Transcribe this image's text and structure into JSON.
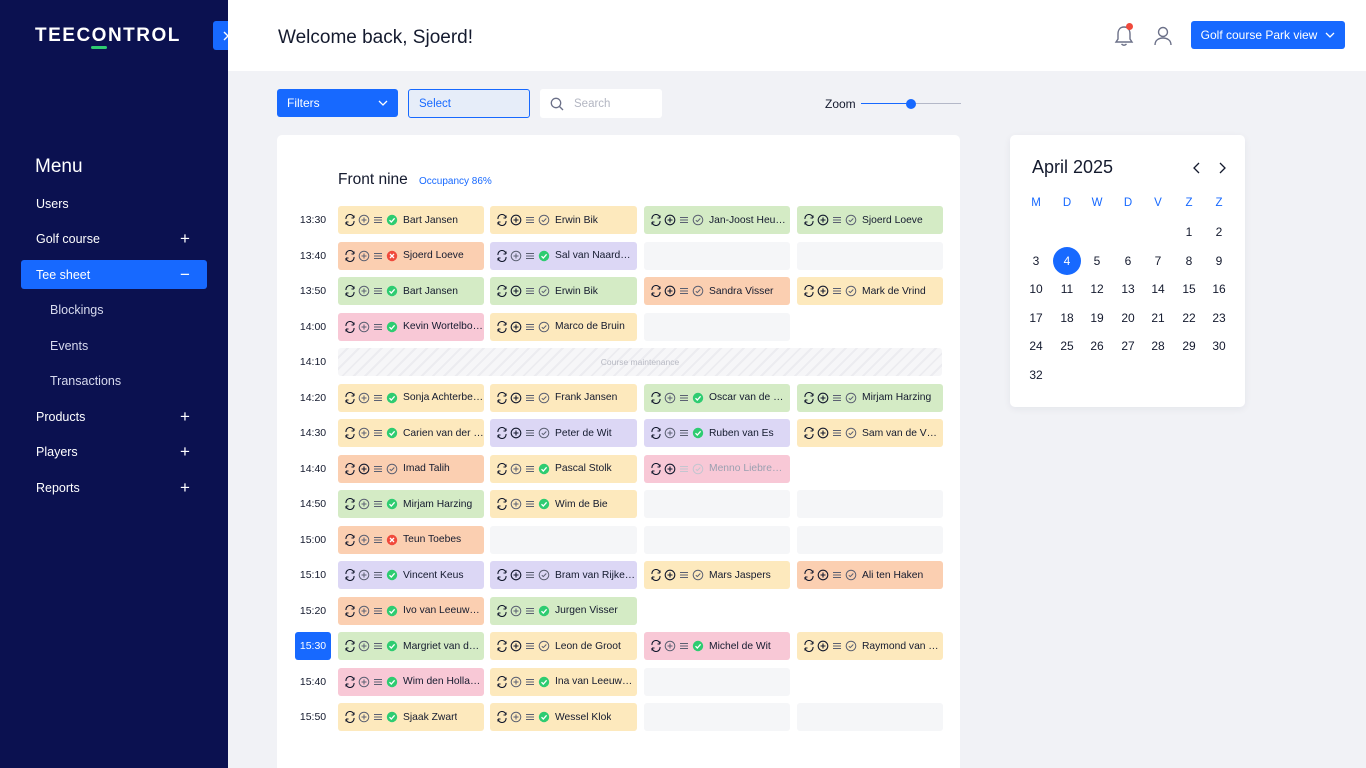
{
  "sidebar": {
    "logo": "TEECONTROL",
    "close_icon": "close-icon",
    "menu_title": "Menu",
    "items": [
      {
        "label": "Users",
        "toggle": "",
        "sub": false,
        "active": false
      },
      {
        "label": "Golf course",
        "toggle": "+",
        "sub": false,
        "active": false
      },
      {
        "label": "Tee sheet",
        "toggle": "−",
        "sub": false,
        "active": true
      },
      {
        "label": "Blockings",
        "toggle": "",
        "sub": true,
        "active": false
      },
      {
        "label": "Events",
        "toggle": "",
        "sub": true,
        "active": false
      },
      {
        "label": "Transactions",
        "toggle": "",
        "sub": true,
        "active": false
      },
      {
        "label": "Products",
        "toggle": "+",
        "sub": false,
        "active": false
      },
      {
        "label": "Players",
        "toggle": "+",
        "sub": false,
        "active": false
      },
      {
        "label": "Reports",
        "toggle": "+",
        "sub": false,
        "active": false
      }
    ]
  },
  "header": {
    "welcome": "Welcome back, Sjoerd!",
    "course_button": "Golf course Park view"
  },
  "toolbar": {
    "filters_label": "Filters",
    "select_label": "Select",
    "search_placeholder": "Search",
    "zoom_label": "Zoom",
    "zoom_level": 0.5
  },
  "teesheet": {
    "title": "Front nine",
    "occupancy": "Occupancy 86%",
    "active_time": "15:30",
    "maintenance_label": "Course maintenance",
    "rows": [
      {
        "time": "13:30",
        "slots": [
          {
            "name": "Bart Jansen",
            "color": "yellow",
            "status": "ok"
          },
          {
            "name": "Erwin Bik",
            "color": "yellow",
            "status": "check"
          },
          {
            "name": "Jan-Joost Heu…",
            "color": "green",
            "status": "check"
          },
          {
            "name": "Sjoerd Loeve",
            "color": "green",
            "status": "check"
          }
        ]
      },
      {
        "time": "13:40",
        "slots": [
          {
            "name": "Sjoerd Loeve",
            "color": "orange",
            "status": "error"
          },
          {
            "name": "Sal van Naard…",
            "color": "purple",
            "status": "ok"
          },
          {
            "name": "",
            "color": "empty"
          },
          {
            "name": "",
            "color": "empty"
          }
        ]
      },
      {
        "time": "13:50",
        "slots": [
          {
            "name": "Bart Jansen",
            "color": "green",
            "status": "ok"
          },
          {
            "name": "Erwin Bik",
            "color": "green",
            "status": "check"
          },
          {
            "name": "Sandra Visser",
            "color": "orange",
            "status": "check"
          },
          {
            "name": "Mark de Vrind",
            "color": "yellow",
            "status": "check"
          }
        ]
      },
      {
        "time": "14:00",
        "slots": [
          {
            "name": "Kevin Wortelbo…",
            "color": "pink",
            "status": "ok"
          },
          {
            "name": "Marco de Bruin",
            "color": "yellow",
            "status": "check"
          },
          {
            "name": "",
            "color": "empty"
          },
          {
            "name": "",
            "color": "none"
          }
        ]
      },
      {
        "time": "14:10",
        "maintenance": true
      },
      {
        "time": "14:20",
        "slots": [
          {
            "name": "Sonja Achterbe…",
            "color": "yellow",
            "status": "ok"
          },
          {
            "name": "Frank Jansen",
            "color": "yellow",
            "status": "check"
          },
          {
            "name": "Oscar van de …",
            "color": "green",
            "status": "ok"
          },
          {
            "name": "Mirjam Harzing",
            "color": "green",
            "status": "check"
          }
        ]
      },
      {
        "time": "14:30",
        "slots": [
          {
            "name": "Carien van der …",
            "color": "yellow",
            "status": "ok"
          },
          {
            "name": "Peter de Wit",
            "color": "purple",
            "status": "check"
          },
          {
            "name": "Ruben van Es",
            "color": "purple",
            "status": "ok"
          },
          {
            "name": "Sam van de V…",
            "color": "yellow",
            "status": "check"
          }
        ]
      },
      {
        "time": "14:40",
        "slots": [
          {
            "name": "Imad Talih",
            "color": "orange",
            "status": "check"
          },
          {
            "name": "Pascal Stolk",
            "color": "yellow",
            "status": "ok"
          },
          {
            "name": "Menno Liebre…",
            "color": "pink",
            "status": "check",
            "dim": true
          },
          {
            "name": "",
            "color": "none"
          }
        ]
      },
      {
        "time": "14:50",
        "slots": [
          {
            "name": "Mirjam Harzing",
            "color": "green",
            "status": "ok"
          },
          {
            "name": "Wim de Bie",
            "color": "yellow",
            "status": "ok"
          },
          {
            "name": "",
            "color": "empty"
          },
          {
            "name": "",
            "color": "empty"
          }
        ]
      },
      {
        "time": "15:00",
        "slots": [
          {
            "name": "Teun Toebes",
            "color": "orange",
            "status": "error"
          },
          {
            "name": "",
            "color": "empty"
          },
          {
            "name": "",
            "color": "empty"
          },
          {
            "name": "",
            "color": "empty"
          }
        ]
      },
      {
        "time": "15:10",
        "slots": [
          {
            "name": "Vincent Keus",
            "color": "purple",
            "status": "ok"
          },
          {
            "name": "Bram van Rijke…",
            "color": "purple",
            "status": "check"
          },
          {
            "name": "Mars Jaspers",
            "color": "yellow",
            "status": "check"
          },
          {
            "name": "Ali ten Haken",
            "color": "orange",
            "status": "check"
          }
        ]
      },
      {
        "time": "15:20",
        "slots": [
          {
            "name": "Ivo van Leeuw…",
            "color": "orange",
            "status": "ok"
          },
          {
            "name": "Jurgen Visser",
            "color": "green",
            "status": "ok"
          },
          {
            "name": "",
            "color": "none"
          },
          {
            "name": "",
            "color": "none"
          }
        ]
      },
      {
        "time": "15:30",
        "slots": [
          {
            "name": "Margriet van d…",
            "color": "green",
            "status": "ok"
          },
          {
            "name": "Leon de Groot",
            "color": "yellow",
            "status": "check"
          },
          {
            "name": "Michel de Wit",
            "color": "pink",
            "status": "ok"
          },
          {
            "name": "Raymond van T…",
            "color": "yellow",
            "status": "check"
          }
        ]
      },
      {
        "time": "15:40",
        "slots": [
          {
            "name": "Wim den Hollan…",
            "color": "pink",
            "status": "ok"
          },
          {
            "name": "Ina van Leeuw…",
            "color": "yellow",
            "status": "ok"
          },
          {
            "name": "",
            "color": "empty"
          },
          {
            "name": "",
            "color": "none"
          }
        ]
      },
      {
        "time": "15:50",
        "slots": [
          {
            "name": "Sjaak Zwart",
            "color": "yellow",
            "status": "ok"
          },
          {
            "name": "Wessel Klok",
            "color": "yellow",
            "status": "ok"
          },
          {
            "name": "",
            "color": "empty"
          },
          {
            "name": "",
            "color": "empty"
          }
        ]
      }
    ]
  },
  "calendar": {
    "title": "April 2025",
    "weekdays": [
      "M",
      "D",
      "W",
      "D",
      "V",
      "Z",
      "Z"
    ],
    "weeks": [
      [
        "",
        "",
        "",
        "",
        "",
        "1",
        "2"
      ],
      [
        "3",
        "4",
        "5",
        "6",
        "7",
        "8",
        "9"
      ],
      [
        "10",
        "11",
        "12",
        "13",
        "14",
        "15",
        "16"
      ],
      [
        "17",
        "18",
        "19",
        "20",
        "21",
        "22",
        "23"
      ],
      [
        "24",
        "25",
        "26",
        "27",
        "28",
        "29",
        "30"
      ],
      [
        "32",
        "",
        "",
        "",
        "",
        "",
        ""
      ]
    ],
    "selected": "4"
  },
  "colors": {
    "accent": "#1769ff",
    "sidebar": "#0b1150",
    "ok": "#2ecc71",
    "error": "#f04a3c"
  }
}
